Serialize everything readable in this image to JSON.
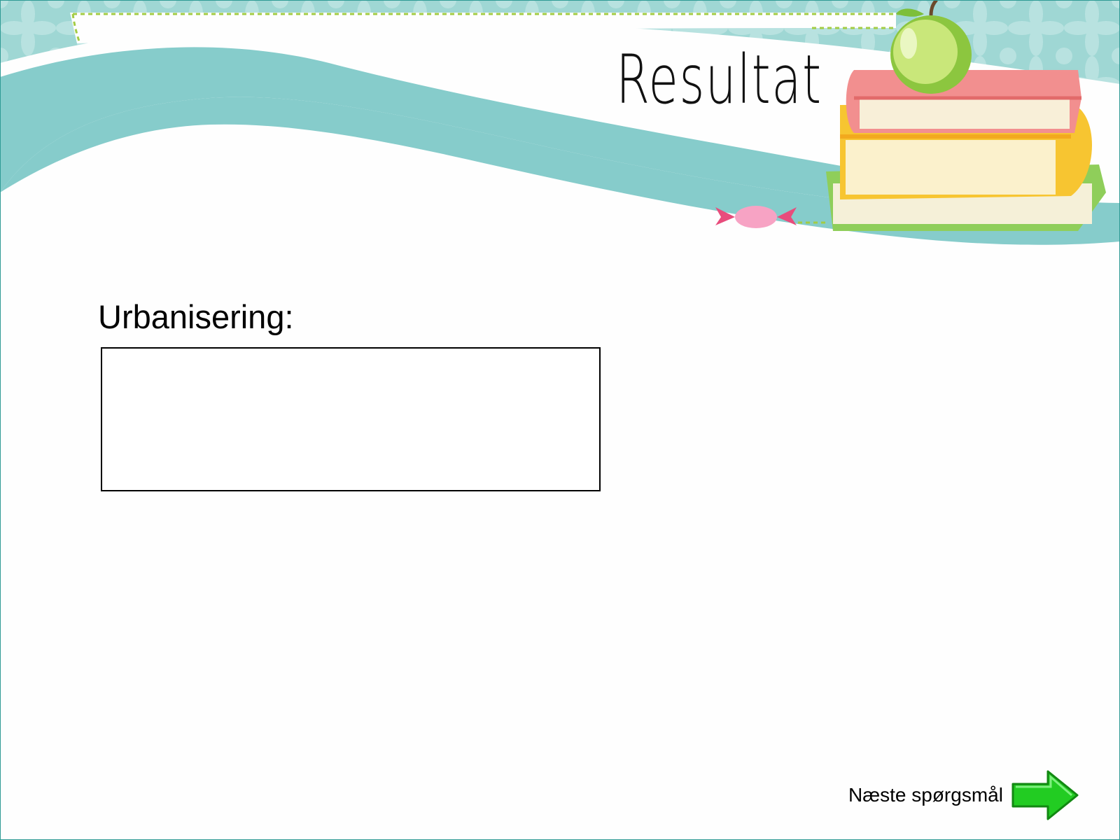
{
  "slide": {
    "title": "Resultat",
    "question_label": "Urbanisering:",
    "answer_value": "",
    "next_label": "Næste spørgsmål"
  },
  "icons": {
    "decoration": "books-apple-icon",
    "candy": "candy-icon",
    "next": "green-arrow-right-icon"
  },
  "colors": {
    "teal_band": "#86cccb",
    "header_pattern": "#9fd7d4",
    "dotted_line": "#a3cc44",
    "arrow_green": "#22cc22",
    "frame": "#2f9b95"
  }
}
